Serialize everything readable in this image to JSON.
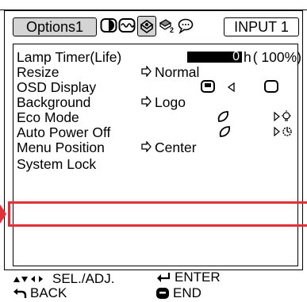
{
  "tabs": {
    "options_label": "Options1",
    "icons": [
      "picture-icon",
      "audio-icon",
      "options1-icon",
      "options2-icon",
      "language-icon"
    ],
    "input_label": "INPUT 1"
  },
  "menu": {
    "lamp_timer": {
      "label": "Lamp Timer(Life)",
      "hours": "0",
      "unit": "h",
      "percent": "( 100%)"
    },
    "resize": {
      "label": "Resize",
      "value": "Normal"
    },
    "osd_display": {
      "label": "OSD Display"
    },
    "background": {
      "label": "Background",
      "value": "Logo"
    },
    "eco_mode": {
      "label": "Eco Mode"
    },
    "auto_power_off": {
      "label": "Auto Power Off"
    },
    "menu_position": {
      "label": "Menu Position",
      "value": "Center"
    },
    "system_lock": {
      "label": "System Lock"
    }
  },
  "footer": {
    "sel_adj": "SEL./ADJ.",
    "enter": "ENTER",
    "back": "BACK",
    "end": "END"
  },
  "colors": {
    "highlight": "#e0303a",
    "tab_bg": "#d4d4d4"
  }
}
